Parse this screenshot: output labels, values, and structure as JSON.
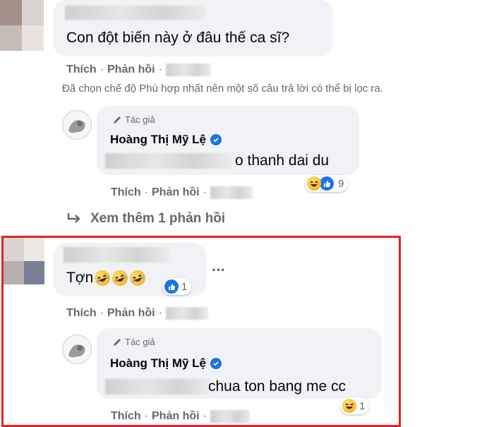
{
  "colors": {
    "highlight_border": "#e02424",
    "verified": "#1b74e4",
    "bubble": "#f0f2f5",
    "meta_text": "#65676b"
  },
  "comment1": {
    "text": "Con đột biến này ở đâu thế ca sĩ?",
    "actions": {
      "like": "Thích",
      "reply": "Phản hồi",
      "dot": "·"
    },
    "filter_notice": "Đã chọn chế độ Phù hợp nhất nên một số câu trả lời có thể bị lọc ra."
  },
  "reply1": {
    "tag": "Tác giả",
    "author": "Hoàng Thị Mỹ Lệ",
    "text": "o thanh dai du",
    "reactions": {
      "icons": [
        "haha-icon",
        "like-icon"
      ],
      "count": "9"
    },
    "actions": {
      "like": "Thích",
      "reply": "Phản hồi",
      "dot": "·"
    }
  },
  "more_replies": {
    "label": "Xem thêm 1 phản hồi",
    "icon": "reply-arrow-icon"
  },
  "comment2": {
    "text": "Tợn",
    "emojis": [
      "rofl-icon",
      "rofl-icon",
      "rofl-icon"
    ],
    "reactions": {
      "icons": [
        "like-icon"
      ],
      "count": "1"
    },
    "more": "···",
    "actions": {
      "like": "Thích",
      "reply": "Phản hồi",
      "dot": "·"
    }
  },
  "reply2": {
    "tag": "Tác giả",
    "author": "Hoàng Thị Mỹ Lệ",
    "text": "chua ton bang me cc",
    "reactions": {
      "icons": [
        "haha-icon"
      ],
      "count": "1"
    },
    "actions": {
      "like": "Thích",
      "reply": "Phản hồi",
      "dot": "·"
    }
  }
}
